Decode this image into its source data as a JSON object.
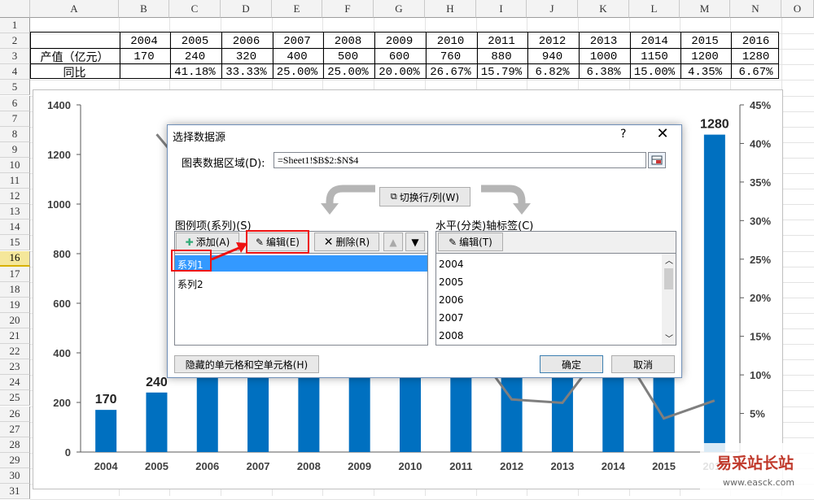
{
  "columns": [
    "A",
    "B",
    "C",
    "D",
    "E",
    "F",
    "G",
    "H",
    "I",
    "J",
    "K",
    "L",
    "M",
    "N",
    "O"
  ],
  "rows": [
    "1",
    "2",
    "3",
    "4",
    "5",
    "6",
    "7",
    "8",
    "9",
    "10",
    "11",
    "12",
    "13",
    "14",
    "15",
    "16",
    "17",
    "18",
    "19",
    "20",
    "21",
    "22",
    "23",
    "24",
    "25",
    "26",
    "27",
    "28",
    "29",
    "30",
    "31"
  ],
  "selected_row": "16",
  "table": {
    "years": [
      "2004",
      "2005",
      "2006",
      "2007",
      "2008",
      "2009",
      "2010",
      "2011",
      "2012",
      "2013",
      "2014",
      "2015",
      "2016"
    ],
    "row3_label": "产值（亿元）",
    "row3_values": [
      "170",
      "240",
      "320",
      "400",
      "500",
      "600",
      "760",
      "880",
      "940",
      "1000",
      "1150",
      "1200",
      "1280"
    ],
    "row4_label": "同比",
    "row4_values": [
      "",
      "41.18%",
      "33.33%",
      "25.00%",
      "25.00%",
      "20.00%",
      "26.67%",
      "15.79%",
      "6.82%",
      "6.38%",
      "15.00%",
      "4.35%",
      "6.67%"
    ]
  },
  "chart_data": {
    "type": "bar",
    "categories": [
      "2004",
      "2005",
      "2006",
      "2007",
      "2008",
      "2009",
      "2010",
      "2011",
      "2012",
      "2013",
      "2014",
      "2015",
      "2016"
    ],
    "series": [
      {
        "values": [
          170,
          240,
          320,
          400,
          500,
          600,
          760,
          880,
          940,
          1000,
          1150,
          1200,
          1280
        ],
        "color": "#0070c0"
      },
      {
        "values": [
          null,
          41.18,
          33.33,
          25.0,
          25.0,
          20.0,
          26.67,
          15.79,
          6.82,
          6.38,
          15.0,
          4.35,
          6.67
        ],
        "color": "#7f7f7f",
        "kind": "line",
        "axis": "right"
      }
    ],
    "ylim": [
      0,
      1400
    ],
    "y_ticks": [
      "0",
      "200",
      "400",
      "600",
      "800",
      "1000",
      "1200",
      "1400"
    ],
    "y2lim": [
      0,
      45
    ],
    "y2_ticks": [
      "5%",
      "10%",
      "15%",
      "20%",
      "25%",
      "30%",
      "35%",
      "40%",
      "45%"
    ],
    "data_labels_visible": [
      "170",
      "240",
      "1280"
    ]
  },
  "dialog": {
    "title": "选择数据源",
    "help": "?",
    "close": "✕",
    "range_label": "图表数据区域(D):",
    "range_value": "=Sheet1!$B$2:$N$4",
    "switch_label": "切换行/列(W)",
    "legend_label": "图例项(系列)(S)",
    "add_label": "添加(A)",
    "edit_label": "编辑(E)",
    "delete_label": "删除(R)",
    "series": [
      "系列1",
      "系列2"
    ],
    "axis_label": "水平(分类)轴标签(C)",
    "axis_edit_label": "编辑(T)",
    "axis_items": [
      "2004",
      "2005",
      "2006",
      "2007",
      "2008"
    ],
    "hidden_cells_label": "隐藏的单元格和空单元格(H)",
    "ok_label": "确定",
    "cancel_label": "取消"
  },
  "watermark": {
    "line1": "易采站长站",
    "line2": "www.easck.com"
  }
}
